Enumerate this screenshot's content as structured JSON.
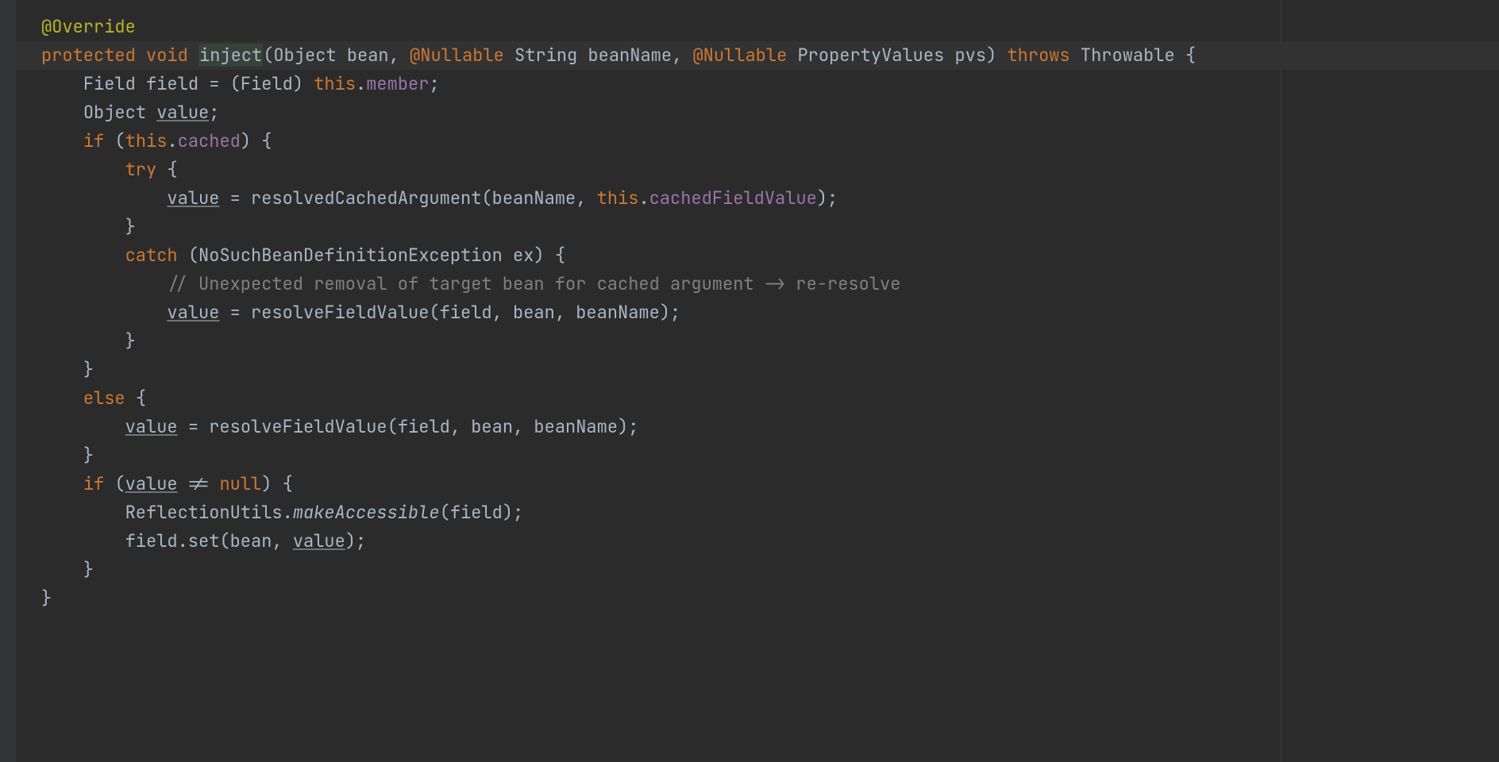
{
  "code": {
    "annotation_override": "@Override",
    "kw_protected": "protected",
    "kw_void": "void",
    "method_name": "inject",
    "sig_rest": "(Object bean, ",
    "nullable1": "@Nullable",
    "sig_after_nullable1": " String beanName, ",
    "nullable2": "@Nullable",
    "sig_after_nullable2": " PropertyValues pvs) ",
    "kw_throws": "throws",
    "throws_type": " Throwable {",
    "l3_pre": "Field field = (Field) ",
    "this1": "this",
    "dot_member": ".",
    "member_field": "member",
    "semi": ";",
    "l4_pre": "Object ",
    "value_u": "value",
    "kw_if": "if",
    "l5_paren": " (",
    "this2": "this",
    "dot_cached": ".",
    "cached_field": "cached",
    "l5_close": ") {",
    "kw_try": "try",
    "l6_brace": " {",
    "l7_val": "value",
    "l7_rest": " = resolvedCachedArgument(beanName, ",
    "this3": "this",
    "dot_cfv": ".",
    "cfv_field": "cachedFieldValue",
    "l7_end": ");",
    "brace_close": "}",
    "kw_catch": "catch",
    "catch_rest": " (NoSuchBeanDefinitionException ex) {",
    "comment": "// Unexpected removal of target bean for cached argument -> re-resolve",
    "l11_val": "value",
    "l11_rest": " = resolveFieldValue(field, bean, beanName);",
    "kw_else": "else",
    "else_brace": " {",
    "l15_val": "value",
    "l15_rest": " = resolveFieldValue(field, bean, beanName);",
    "l17_if": "if",
    "l17_open": " (",
    "l17_val": "value",
    "l17_rest": " != ",
    "kw_null": "null",
    "l17_close": ") {",
    "l18_pre": "ReflectionUtils.",
    "makeAccessible": "makeAccessible",
    "l18_post": "(field);",
    "l19_pre": "field.set(bean, ",
    "l19_val": "value",
    "l19_post": ");"
  }
}
